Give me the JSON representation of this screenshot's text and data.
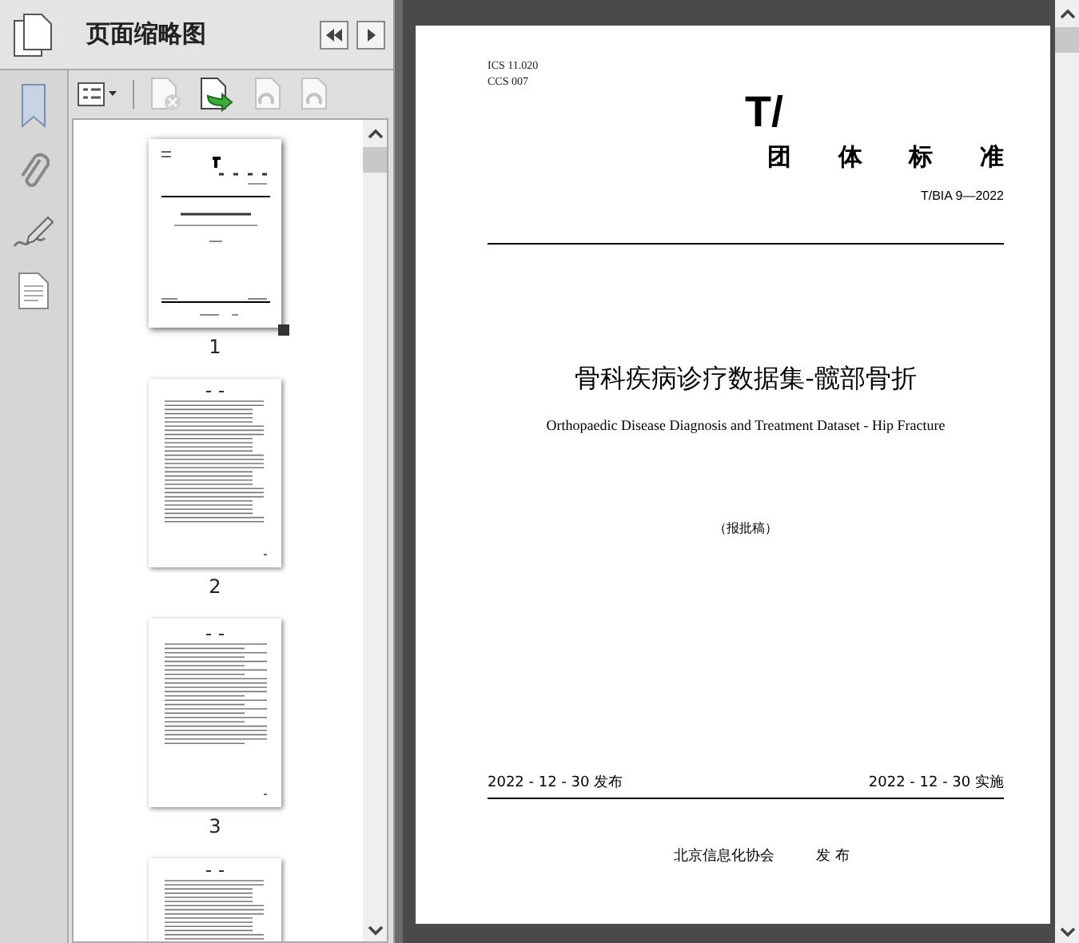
{
  "panel": {
    "title": "页面缩略图"
  },
  "thumbnails": [
    {
      "label": "1",
      "selected": true,
      "kind": "cover"
    },
    {
      "label": "2",
      "selected": false,
      "kind": "contents"
    },
    {
      "label": "3",
      "selected": false,
      "kind": "text"
    },
    {
      "selected": false,
      "kind": "contents"
    }
  ],
  "page": {
    "ics": "ICS  11.020",
    "ccs": "CCS  007",
    "logo": "T/",
    "category": [
      "团",
      "体",
      "标",
      "准"
    ],
    "code": "T/BIA 9—2022",
    "title": "骨科疾病诊疗数据集-髋部骨折",
    "subtitle": "Orthopaedic Disease Diagnosis and Treatment Dataset - Hip Fracture",
    "stage": "（报批稿）",
    "publish_date": "2022 - 12 - 30 发布",
    "effective_date": "2022 - 12 - 30 实施",
    "publisher": "北京信息化协会",
    "publish_word": "发  布"
  }
}
